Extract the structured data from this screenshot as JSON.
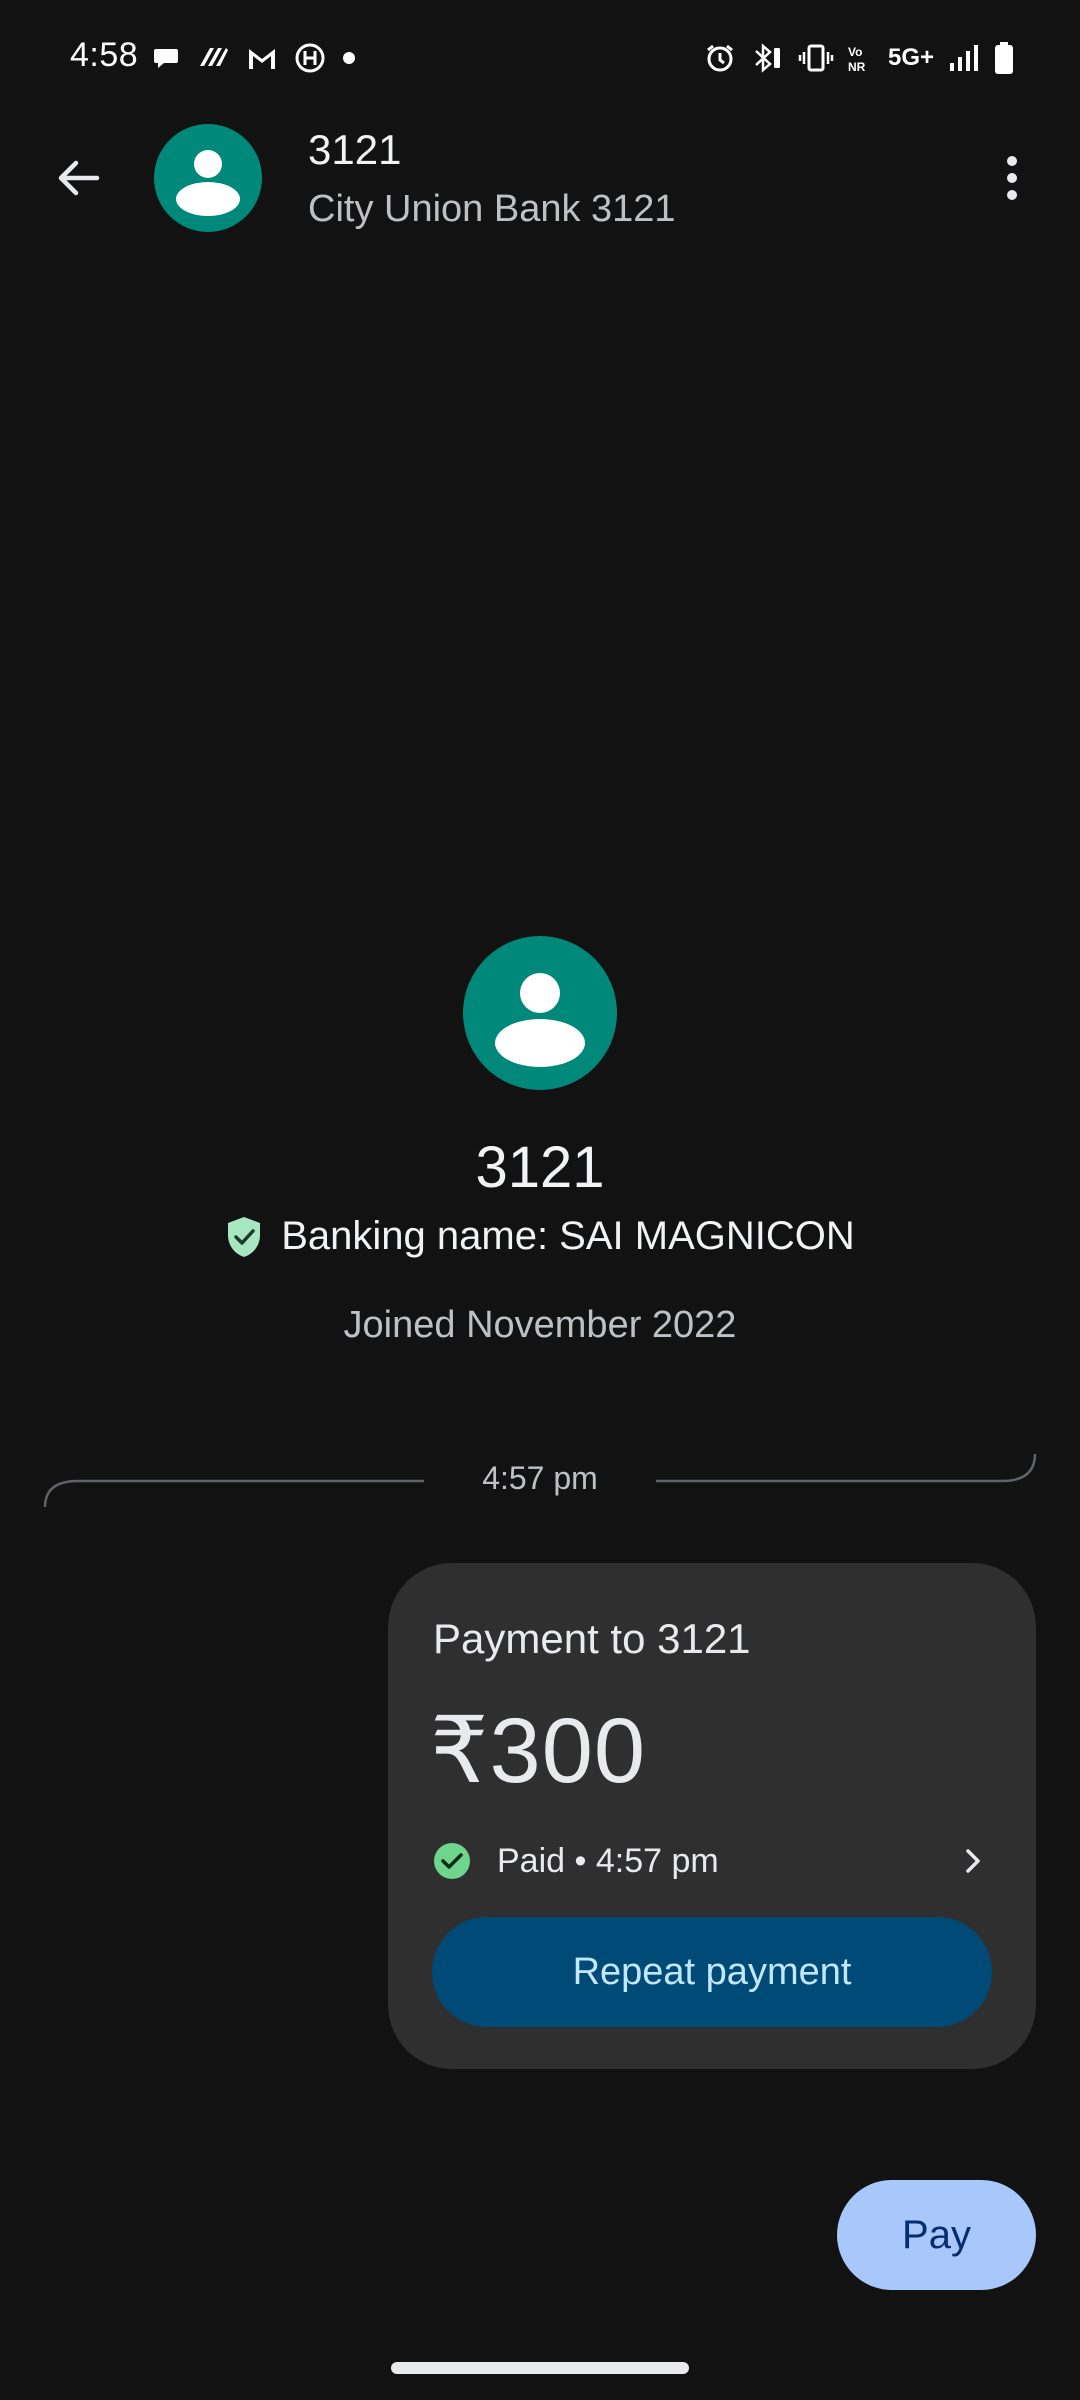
{
  "status_bar": {
    "time": "4:58",
    "network_label": "5G+",
    "left_icons": [
      "chat-icon",
      "app-icon",
      "gmail-icon",
      "h-app-icon",
      "dot-icon"
    ],
    "right_icons": [
      "alarm-icon",
      "bluetooth-icon",
      "vibrate-icon",
      "vonr-icon",
      "signal-icon",
      "battery-icon"
    ]
  },
  "header": {
    "title": "3121",
    "subtitle": "City Union Bank 3121",
    "avatar_color": "#00897b"
  },
  "profile": {
    "name": "3121",
    "banking_name": "Banking name: SAI MAGNICON",
    "joined": "Joined November 2022",
    "shield_color": "#a8e6c1"
  },
  "timeline": {
    "time": "4:57 pm"
  },
  "payment_card": {
    "title": "Payment to 3121",
    "amount": "₹300",
    "status": "Paid • 4:57 pm",
    "status_color": "#6dd58c",
    "repeat_label": "Repeat payment"
  },
  "fab": {
    "pay_label": "Pay"
  }
}
